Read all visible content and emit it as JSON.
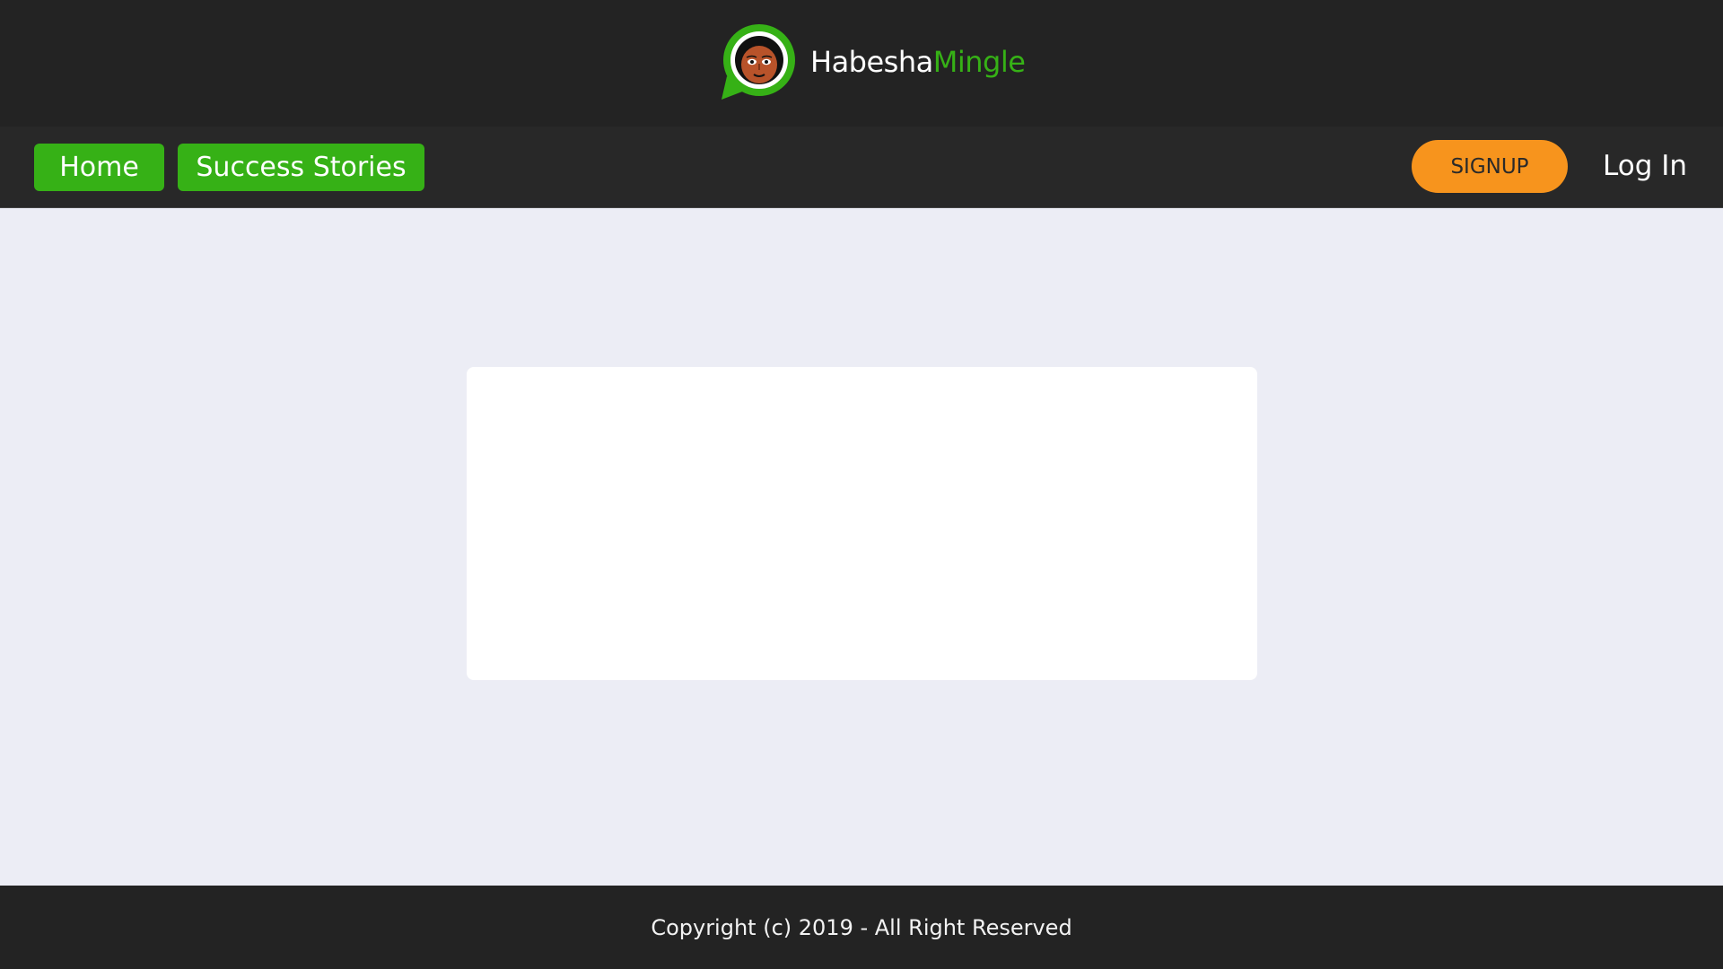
{
  "header": {
    "brand_part1": "Habesha",
    "brand_part2": "Mingle",
    "logo_icon": "avatar-chat-bubble-icon"
  },
  "nav": {
    "home_label": "Home",
    "success_stories_label": "Success Stories",
    "signup_label": "SIGNUP",
    "login_label": "Log In"
  },
  "footer": {
    "copyright": "Copyright (c) 2019 - All Right Reserved"
  },
  "colors": {
    "header_bg": "#232323",
    "nav_bg": "#282828",
    "accent_green": "#36b116",
    "signup_orange": "#f7941d",
    "page_bg": "#ecedf5",
    "card_bg": "#ffffff"
  }
}
